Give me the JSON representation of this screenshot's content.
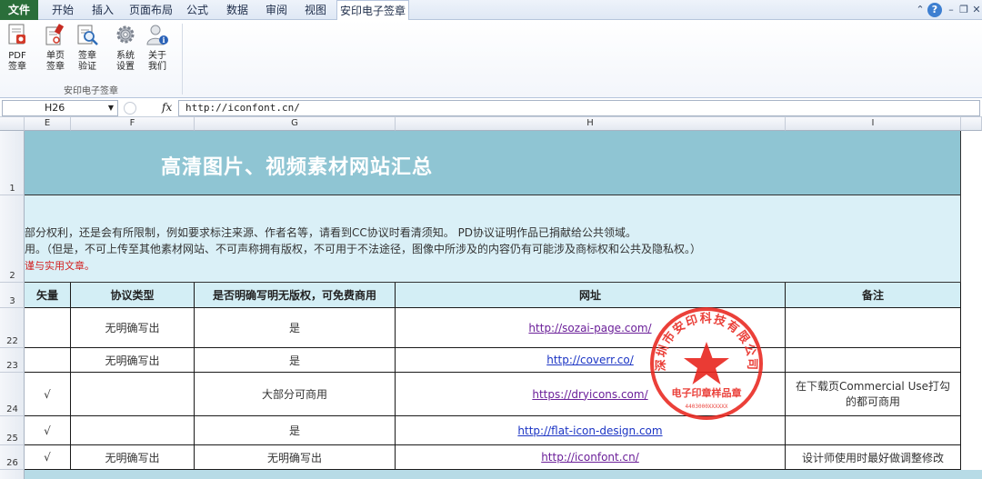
{
  "ribbon_tabs": [
    {
      "label": "文件"
    },
    {
      "label": "开始"
    },
    {
      "label": "插入"
    },
    {
      "label": "页面布局"
    },
    {
      "label": "公式"
    },
    {
      "label": "数据"
    },
    {
      "label": "审阅"
    },
    {
      "label": "视图"
    },
    {
      "label": "安印电子签章"
    }
  ],
  "ribbon": {
    "buttons": [
      {
        "line1": "PDF",
        "line2": "签章",
        "icon": "pdf-sign-icon"
      },
      {
        "line1": "单页",
        "line2": "签章",
        "icon": "single-page-sign-icon"
      },
      {
        "line1": "签章",
        "line2": "验证",
        "icon": "verify-sign-icon"
      },
      {
        "line1": "系统",
        "line2": "设置",
        "icon": "gear-icon"
      },
      {
        "line1": "关于",
        "line2": "我们",
        "icon": "about-user-icon"
      }
    ],
    "group_label": "安印电子签章"
  },
  "formula_bar": {
    "name_box": "H26",
    "fx_label": "fx",
    "formula": "http://iconfont.cn/"
  },
  "columns": [
    {
      "label": "E"
    },
    {
      "label": "F"
    },
    {
      "label": "G"
    },
    {
      "label": "H"
    },
    {
      "label": "I"
    }
  ],
  "rows": [
    {
      "label": "1"
    },
    {
      "label": "2"
    },
    {
      "label": "3"
    },
    {
      "label": "22"
    },
    {
      "label": "23"
    },
    {
      "label": "24"
    },
    {
      "label": "25"
    },
    {
      "label": "26"
    }
  ],
  "sheet": {
    "title": "高清图片、视频素材网站汇总",
    "notes": [
      "部分权利，还是会有所限制，例如要求标注来源、作者名等，请看到CC协议时看清须知。 PD协议证明作品已捐献给公共领域。",
      "用。（但是，不可上传至其他素材网站、不可声称拥有版权，不可用于不法途径，图像中所涉及的内容仍有可能涉及商标权和公共及隐私权。）",
      "谨与实用文章。"
    ],
    "headers": [
      "矢量",
      "协议类型",
      "是否明确写明无版权，可免费商用",
      "网址",
      "备注"
    ],
    "data_rows": [
      {
        "vector": "",
        "license": "无明确写出",
        "free": "是",
        "url": "http://sozai-page.com/",
        "note": ""
      },
      {
        "vector": "",
        "license": "无明确写出",
        "free": "是",
        "url": "http://coverr.co/",
        "note": ""
      },
      {
        "vector": "√",
        "license": "",
        "free": "大部分可商用",
        "url": "https://dryicons.com/",
        "note": "在下载页Commercial Use打勾的都可商用"
      },
      {
        "vector": "√",
        "license": "",
        "free": "是",
        "url": "http://flat-icon-design.com",
        "note": ""
      },
      {
        "vector": "√",
        "license": "无明确写出",
        "free": "无明确写出",
        "url": "http://iconfont.cn/",
        "note": "设计师使用时最好做调整修改"
      }
    ]
  },
  "stamp": {
    "ring_text": "深圳市安印科技有限公司",
    "inner_text": "电子印章样品章",
    "serial": "4403000XXXXXX",
    "color": "#e8261e"
  }
}
